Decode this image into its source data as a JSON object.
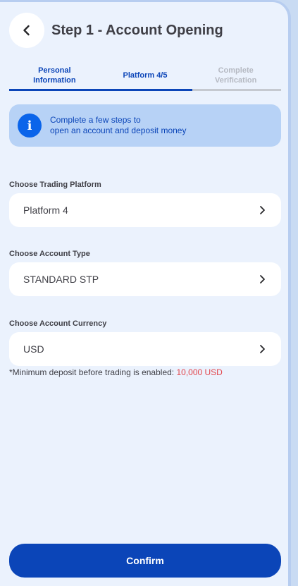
{
  "header": {
    "title": "Step 1 - Account Opening",
    "back_icon": "chevron-left-icon"
  },
  "tabs": [
    {
      "line1": "Personal",
      "line2": "Information",
      "state": "completed"
    },
    {
      "line1": "Platform 4/5",
      "line2": "",
      "state": "active"
    },
    {
      "line1": "Complete",
      "line2": "Verification",
      "state": "disabled"
    }
  ],
  "info": {
    "icon": "info-icon",
    "line1": "Complete a few steps to",
    "line2": "open an account and deposit money"
  },
  "fields": {
    "platform": {
      "label": "Choose Trading Platform",
      "value": "Platform 4"
    },
    "account_type": {
      "label": "Choose Account Type",
      "value": "STANDARD STP"
    },
    "currency": {
      "label": "Choose Account Currency",
      "value": "USD"
    }
  },
  "note": {
    "text": "*Minimum deposit before trading is enabled: ",
    "amount": "10,000 USD"
  },
  "confirm_label": "Confirm",
  "colors": {
    "primary": "#0b45b8",
    "background": "#ebf2fd",
    "info_bg": "#b7d2f6",
    "warning": "#e2454b"
  }
}
